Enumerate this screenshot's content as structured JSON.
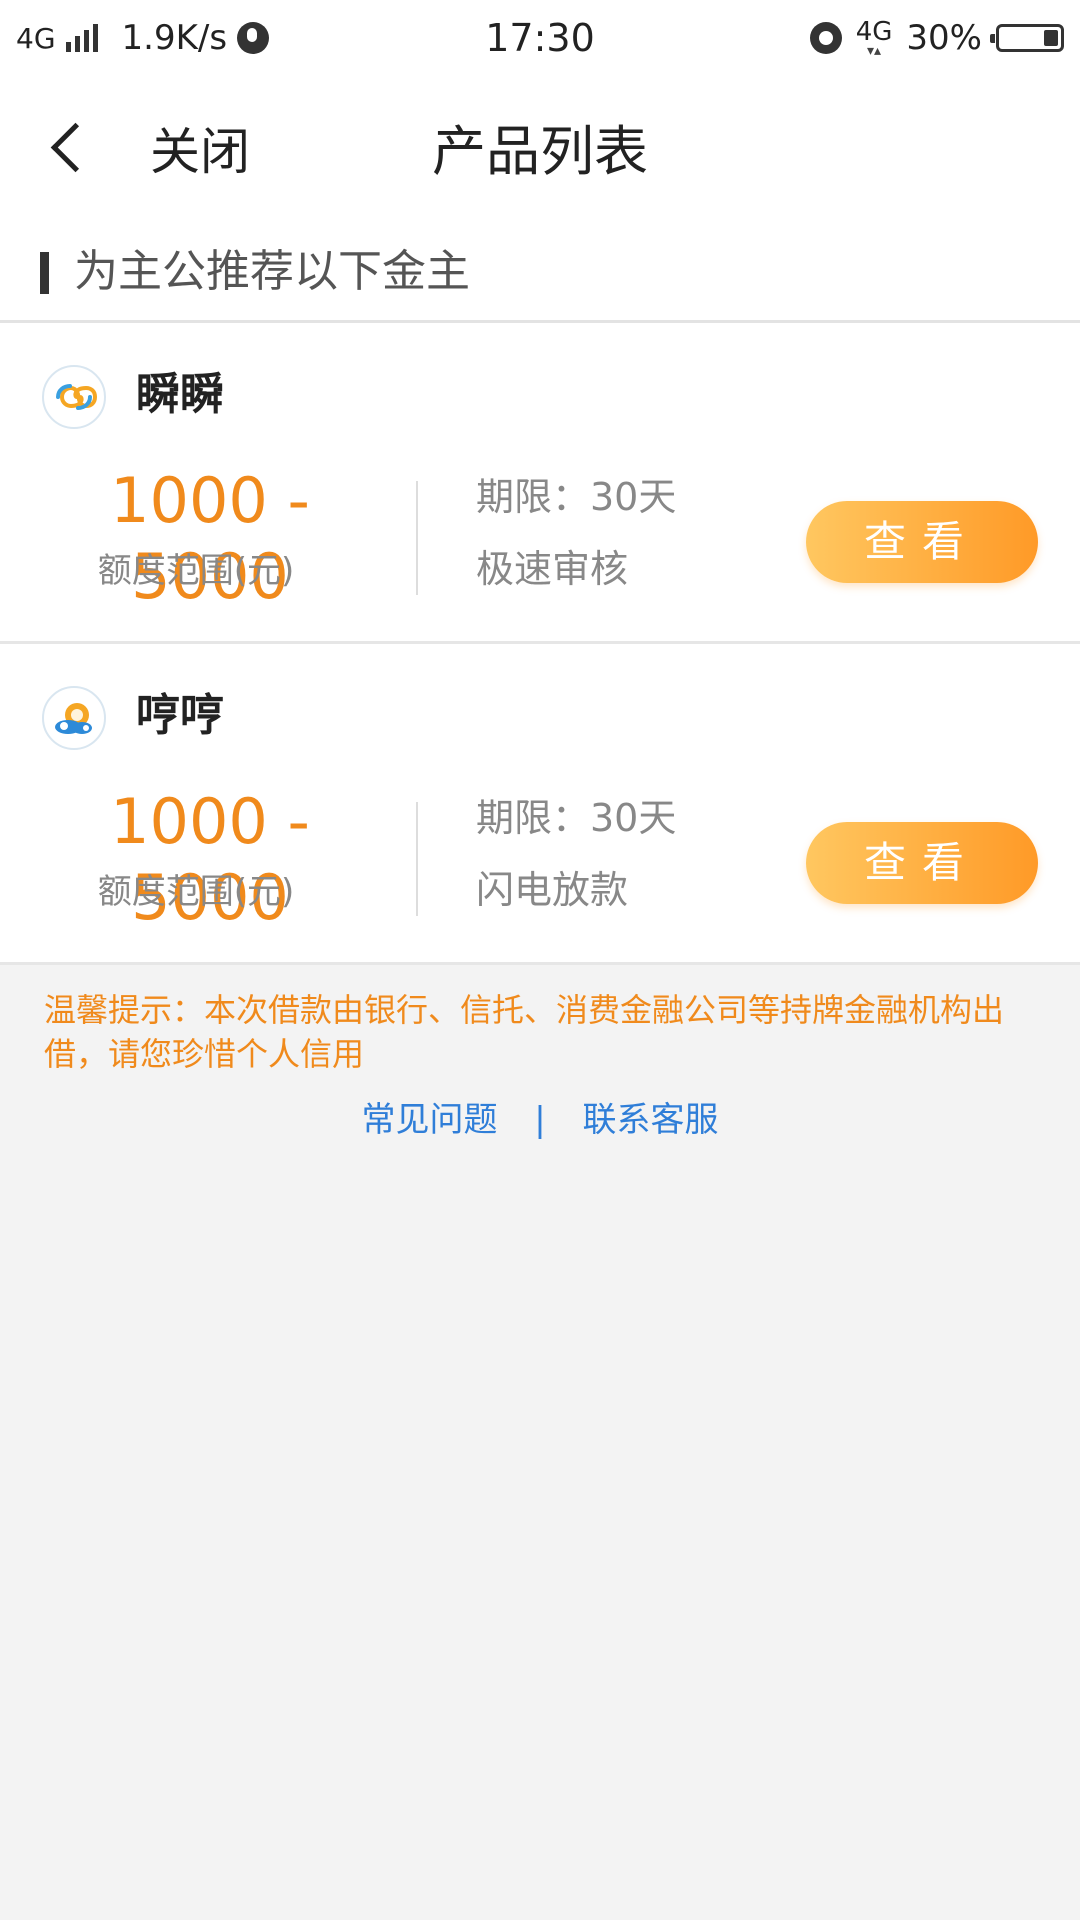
{
  "status_bar": {
    "network": "4G",
    "speed": "1.9K/s",
    "time": "17:30",
    "network_right": "4G",
    "battery": "30%"
  },
  "header": {
    "close_label": "关闭",
    "title": "产品列表"
  },
  "section": {
    "title": "为主公推荐以下金主"
  },
  "products": [
    {
      "name": "瞬瞬",
      "logo": "infinity-logo-icon",
      "amount": "1000 - 5000",
      "amount_label": "额度范围(元)",
      "term": "期限：30天",
      "feature": "极速审核",
      "button": "查看"
    },
    {
      "name": "哼哼",
      "logo": "coin-cloud-logo-icon",
      "amount": "1000 - 5000",
      "amount_label": "额度范围(元)",
      "term": "期限：30天",
      "feature": "闪电放款",
      "button": "查看"
    }
  ],
  "notice": "温馨提示：本次借款由银行、信托、消费金融公司等持牌金融机构出借，请您珍惜个人信用",
  "links": {
    "faq": "常见问题",
    "separator": "|",
    "contact": "联系客服"
  },
  "colors": {
    "accent_orange": "#f08a1c",
    "button_gradient_start": "#ffc760",
    "button_gradient_end": "#ff9a27",
    "link_blue": "#2f7ed8"
  }
}
